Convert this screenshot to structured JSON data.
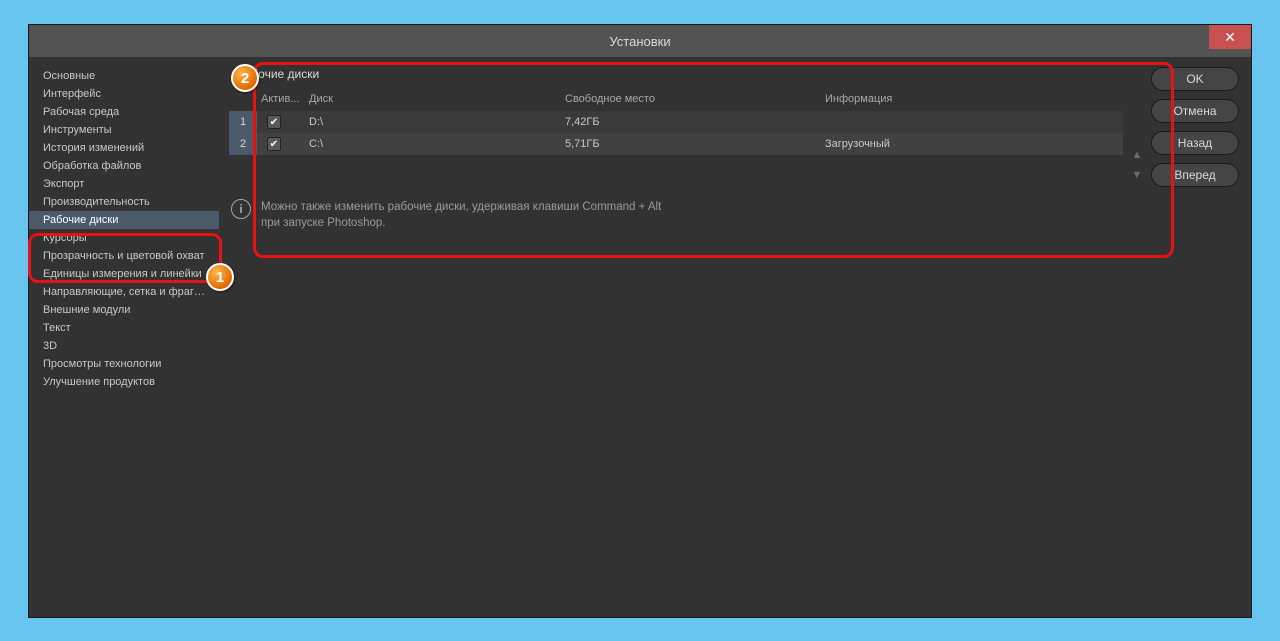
{
  "title": "Установки",
  "close_label": "✕",
  "sidebar": {
    "items": [
      "Основные",
      "Интерфейс",
      "Рабочая среда",
      "Инструменты",
      "История изменений",
      "Обработка файлов",
      "Экспорт",
      "Производительность",
      "Рабочие диски",
      "Курсоры",
      "Прозрачность и цветовой охват",
      "Единицы измерения и линейки",
      "Направляющие, сетка и фрагменты",
      "Внешние модули",
      "Текст",
      "3D",
      "Просмотры технологии",
      "Улучшение продуктов"
    ],
    "active_index": 8
  },
  "panel": {
    "title": "Рабочие диски",
    "headers": {
      "active": "Актив...",
      "disk": "Диск",
      "free": "Свободное место",
      "info": "Информация"
    },
    "rows": [
      {
        "num": "1",
        "checked": true,
        "disk": "D:\\",
        "free": "7,42ГБ",
        "info": ""
      },
      {
        "num": "2",
        "checked": true,
        "disk": "C:\\",
        "free": "5,71ГБ",
        "info": "Загрузочный"
      }
    ]
  },
  "hint": {
    "line1": "Можно также изменить рабочие диски, удерживая клавиши Command + Alt",
    "line2": "при запуске Photoshop."
  },
  "buttons": {
    "ok": "OK",
    "cancel": "Отмена",
    "back": "Назад",
    "next": "Вперед"
  },
  "arrows": {
    "up": "▲",
    "down": "▼"
  },
  "check_glyph": "✔",
  "info_glyph": "i",
  "callouts": {
    "one": "1",
    "two": "2"
  }
}
